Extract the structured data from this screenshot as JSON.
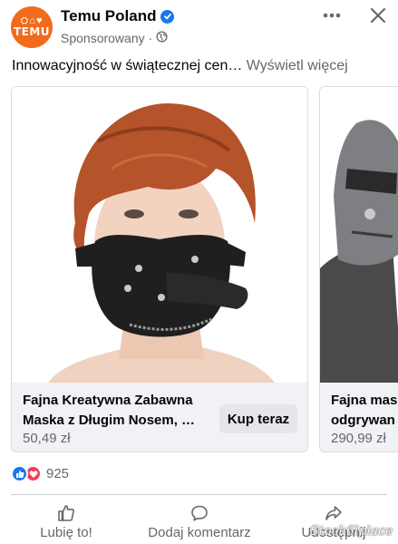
{
  "post": {
    "page_name": "Temu Poland",
    "sponsored_label": "Sponsorowany",
    "caption_text": "Innowacyjność w świątecznej cen…",
    "see_more_label": "Wyświetl więcej",
    "avatar": {
      "glyphs": "⛭⌂♥",
      "logo_text": "TEMU",
      "brand_color": "#f26a1b"
    },
    "icons": {
      "verified": "verified-badge-icon",
      "privacy": "globe-icon",
      "more": "more-options-icon",
      "close": "close-icon"
    }
  },
  "carousel": {
    "cards": [
      {
        "title_line1": "Fajna Kreatywna Zabawna",
        "title_line2": "Maska z Długim Nosem, …",
        "price": "50,49 zł",
        "cta_label": "Kup teraz"
      },
      {
        "title_line1": "Fajna mas",
        "title_line2": "odgrywan",
        "price": "290,99 zł"
      }
    ]
  },
  "reactions": {
    "count": "925",
    "types": [
      "like-reaction-icon",
      "love-reaction-icon"
    ]
  },
  "actions": {
    "like_label": "Lubię to!",
    "comment_label": "Dodaj komentarz",
    "share_label": "Udostępnij"
  },
  "watermark": {
    "text": "Stock6lplace"
  },
  "colors": {
    "accent": "#1877f2",
    "love": "#f33e58",
    "muted_text": "#65676b",
    "card_info_bg": "#f0f2f5"
  }
}
